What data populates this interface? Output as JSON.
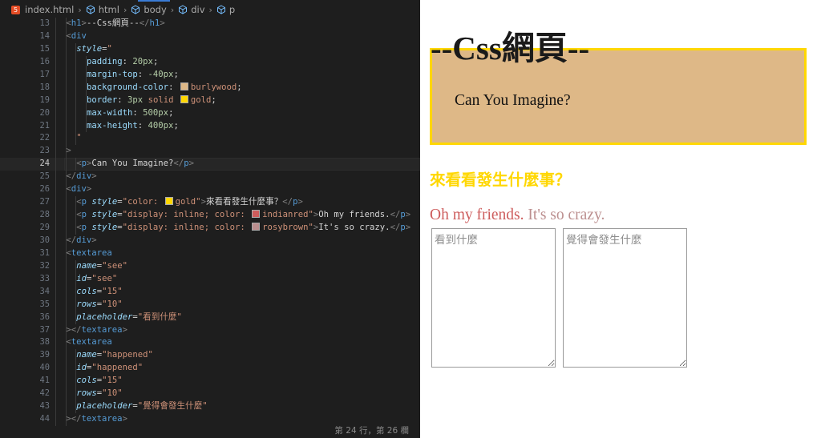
{
  "breadcrumb": {
    "file": "index.html",
    "items": [
      "html",
      "body",
      "div",
      "p"
    ]
  },
  "editor": {
    "active_line": 24,
    "lines": [
      {
        "n": "13",
        "indent": 3,
        "parts": [
          [
            "br",
            "<"
          ],
          [
            "tag",
            "h1"
          ],
          [
            "br",
            ">"
          ],
          [
            "plain",
            "--Css網頁--"
          ],
          [
            "br",
            "</"
          ],
          [
            "tag",
            "h1"
          ],
          [
            "br",
            ">"
          ]
        ]
      },
      {
        "n": "14",
        "indent": 3,
        "parts": [
          [
            "br",
            "<"
          ],
          [
            "tag",
            "div"
          ]
        ]
      },
      {
        "n": "15",
        "indent": 4,
        "parts": [
          [
            "attr",
            "style"
          ],
          [
            "eq",
            "="
          ],
          [
            "str",
            "\""
          ]
        ]
      },
      {
        "n": "16",
        "indent": 5,
        "parts": [
          [
            "css-p",
            "padding"
          ],
          [
            "plain",
            ": "
          ],
          [
            "css-v",
            "20px"
          ],
          [
            "plain",
            ";"
          ]
        ]
      },
      {
        "n": "17",
        "indent": 5,
        "parts": [
          [
            "css-p",
            "margin-top"
          ],
          [
            "plain",
            ": "
          ],
          [
            "css-v",
            "-40px"
          ],
          [
            "plain",
            ";"
          ]
        ]
      },
      {
        "n": "18",
        "indent": 5,
        "parts": [
          [
            "css-p",
            "background-color"
          ],
          [
            "plain",
            ": "
          ],
          [
            "swatch",
            "#deb887"
          ],
          [
            "css-w",
            "burlywood"
          ],
          [
            "plain",
            ";"
          ]
        ]
      },
      {
        "n": "19",
        "indent": 5,
        "parts": [
          [
            "css-p",
            "border"
          ],
          [
            "plain",
            ": "
          ],
          [
            "css-v",
            "3px"
          ],
          [
            "plain",
            " "
          ],
          [
            "css-w",
            "solid"
          ],
          [
            "plain",
            " "
          ],
          [
            "swatch",
            "#ffd700"
          ],
          [
            "css-w",
            "gold"
          ],
          [
            "plain",
            ";"
          ]
        ]
      },
      {
        "n": "20",
        "indent": 5,
        "parts": [
          [
            "css-p",
            "max-width"
          ],
          [
            "plain",
            ": "
          ],
          [
            "css-v",
            "500px"
          ],
          [
            "plain",
            ";"
          ]
        ]
      },
      {
        "n": "21",
        "indent": 5,
        "parts": [
          [
            "css-p",
            "max-height"
          ],
          [
            "plain",
            ": "
          ],
          [
            "css-v",
            "400px"
          ],
          [
            "plain",
            ";"
          ]
        ]
      },
      {
        "n": "22",
        "indent": 4,
        "parts": [
          [
            "str",
            "\""
          ]
        ]
      },
      {
        "n": "23",
        "indent": 3,
        "parts": [
          [
            "br",
            ">"
          ]
        ]
      },
      {
        "n": "24",
        "indent": 4,
        "parts": [
          [
            "br",
            "<"
          ],
          [
            "tag",
            "p"
          ],
          [
            "br",
            ">"
          ],
          [
            "plain",
            "Can You Imagine?"
          ],
          [
            "br",
            "</"
          ],
          [
            "tag",
            "p"
          ],
          [
            "br",
            ">"
          ]
        ]
      },
      {
        "n": "25",
        "indent": 3,
        "parts": [
          [
            "br",
            "</"
          ],
          [
            "tag",
            "div"
          ],
          [
            "br",
            ">"
          ]
        ]
      },
      {
        "n": "26",
        "indent": 3,
        "parts": [
          [
            "br",
            "<"
          ],
          [
            "tag",
            "div"
          ],
          [
            "br",
            ">"
          ]
        ]
      },
      {
        "n": "27",
        "indent": 4,
        "parts": [
          [
            "br",
            "<"
          ],
          [
            "tag",
            "p"
          ],
          [
            "plain",
            " "
          ],
          [
            "attr",
            "style"
          ],
          [
            "eq",
            "="
          ],
          [
            "str",
            "\"color: "
          ],
          [
            "swatch",
            "#ffd700"
          ],
          [
            "str",
            "gold\""
          ],
          [
            "br",
            ">"
          ],
          [
            "plain",
            "來看看發生什麼事？"
          ],
          [
            "br",
            "</"
          ],
          [
            "tag",
            "p"
          ],
          [
            "br",
            ">"
          ]
        ]
      },
      {
        "n": "28",
        "indent": 4,
        "parts": [
          [
            "br",
            "<"
          ],
          [
            "tag",
            "p"
          ],
          [
            "plain",
            " "
          ],
          [
            "attr",
            "style"
          ],
          [
            "eq",
            "="
          ],
          [
            "str",
            "\"display: inline; color: "
          ],
          [
            "swatch",
            "#cd5c5c"
          ],
          [
            "str",
            "indianred\""
          ],
          [
            "br",
            ">"
          ],
          [
            "plain",
            "Oh my friends."
          ],
          [
            "br",
            "</"
          ],
          [
            "tag",
            "p"
          ],
          [
            "br",
            ">"
          ]
        ]
      },
      {
        "n": "29",
        "indent": 4,
        "parts": [
          [
            "br",
            "<"
          ],
          [
            "tag",
            "p"
          ],
          [
            "plain",
            " "
          ],
          [
            "attr",
            "style"
          ],
          [
            "eq",
            "="
          ],
          [
            "str",
            "\"display: inline; color: "
          ],
          [
            "swatch",
            "#bc8f8f"
          ],
          [
            "str",
            "rosybrown\""
          ],
          [
            "br",
            ">"
          ],
          [
            "plain",
            "It's so crazy."
          ],
          [
            "br",
            "</"
          ],
          [
            "tag",
            "p"
          ],
          [
            "br",
            ">"
          ]
        ]
      },
      {
        "n": "30",
        "indent": 3,
        "parts": [
          [
            "br",
            "</"
          ],
          [
            "tag",
            "div"
          ],
          [
            "br",
            ">"
          ]
        ]
      },
      {
        "n": "31",
        "indent": 3,
        "parts": [
          [
            "br",
            "<"
          ],
          [
            "tag",
            "textarea"
          ]
        ]
      },
      {
        "n": "32",
        "indent": 4,
        "parts": [
          [
            "attr",
            "name"
          ],
          [
            "eq",
            "="
          ],
          [
            "str",
            "\"see\""
          ]
        ]
      },
      {
        "n": "33",
        "indent": 4,
        "parts": [
          [
            "attr",
            "id"
          ],
          [
            "eq",
            "="
          ],
          [
            "str",
            "\"see\""
          ]
        ]
      },
      {
        "n": "34",
        "indent": 4,
        "parts": [
          [
            "attr",
            "cols"
          ],
          [
            "eq",
            "="
          ],
          [
            "str",
            "\"15\""
          ]
        ]
      },
      {
        "n": "35",
        "indent": 4,
        "parts": [
          [
            "attr",
            "rows"
          ],
          [
            "eq",
            "="
          ],
          [
            "str",
            "\"10\""
          ]
        ]
      },
      {
        "n": "36",
        "indent": 4,
        "parts": [
          [
            "attr",
            "placeholder"
          ],
          [
            "eq",
            "="
          ],
          [
            "str",
            "\"看到什麼\""
          ]
        ]
      },
      {
        "n": "37",
        "indent": 3,
        "parts": [
          [
            "br",
            "></"
          ],
          [
            "tag",
            "textarea"
          ],
          [
            "br",
            ">"
          ]
        ]
      },
      {
        "n": "38",
        "indent": 3,
        "parts": [
          [
            "br",
            "<"
          ],
          [
            "tag",
            "textarea"
          ]
        ]
      },
      {
        "n": "39",
        "indent": 4,
        "parts": [
          [
            "attr",
            "name"
          ],
          [
            "eq",
            "="
          ],
          [
            "str",
            "\"happened\""
          ]
        ]
      },
      {
        "n": "40",
        "indent": 4,
        "parts": [
          [
            "attr",
            "id"
          ],
          [
            "eq",
            "="
          ],
          [
            "str",
            "\"happened\""
          ]
        ]
      },
      {
        "n": "41",
        "indent": 4,
        "parts": [
          [
            "attr",
            "cols"
          ],
          [
            "eq",
            "="
          ],
          [
            "str",
            "\"15\""
          ]
        ]
      },
      {
        "n": "42",
        "indent": 4,
        "parts": [
          [
            "attr",
            "rows"
          ],
          [
            "eq",
            "="
          ],
          [
            "str",
            "\"10\""
          ]
        ]
      },
      {
        "n": "43",
        "indent": 4,
        "parts": [
          [
            "attr",
            "placeholder"
          ],
          [
            "eq",
            "="
          ],
          [
            "str",
            "\"覺得會發生什麼\""
          ]
        ]
      },
      {
        "n": "44",
        "indent": 3,
        "parts": [
          [
            "br",
            "></"
          ],
          [
            "tag",
            "textarea"
          ],
          [
            "br",
            ">"
          ]
        ]
      }
    ]
  },
  "status_bar": {
    "cursor_position": "第 24 行，第 26 欄"
  },
  "preview": {
    "heading": "--Css網頁--",
    "box_text": "Can You Imagine?",
    "gold_text": "來看看發生什麼事？",
    "friends_text": "Oh my friends.",
    "crazy_text": "It's so crazy.",
    "textarea_see": {
      "placeholder": "看到什麼"
    },
    "textarea_happened": {
      "placeholder": "覺得會發生什麼"
    }
  },
  "colors": {
    "burlywood": "#deb887",
    "gold": "#ffd700",
    "indianred": "#cd5c5c",
    "rosybrown": "#bc8f8f"
  }
}
